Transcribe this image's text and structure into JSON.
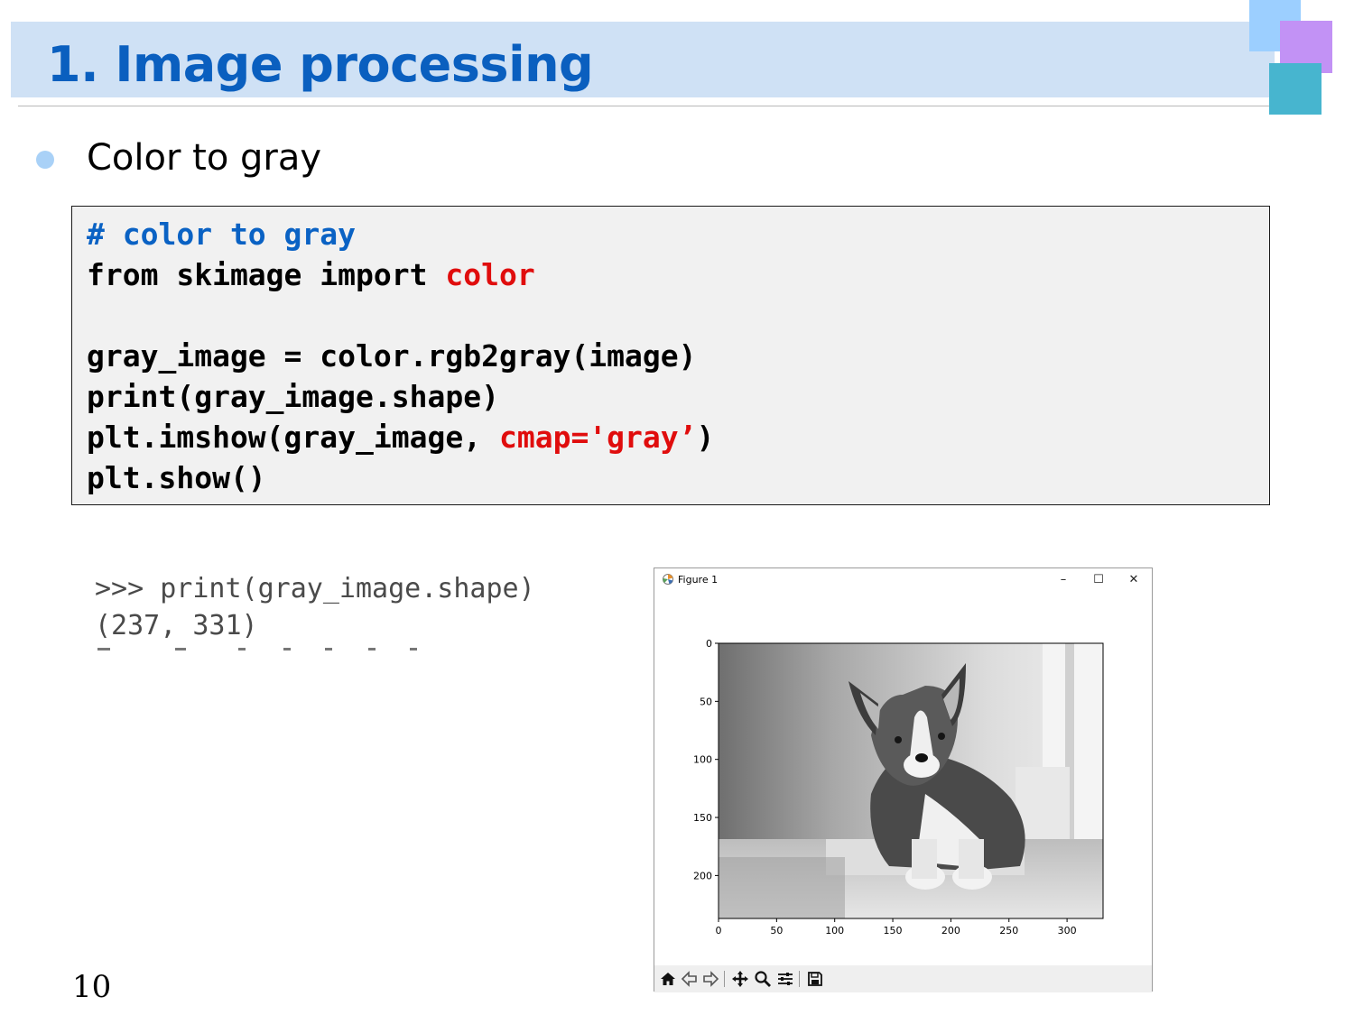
{
  "slide": {
    "title": "1. Image processing",
    "page_number": "10",
    "colors": {
      "title": "#0a5fbf",
      "band": "#cfe1f5",
      "accent_blue": "#9ccfff",
      "accent_purple": "#c292f5",
      "accent_teal": "#47b5cf"
    }
  },
  "bullet": {
    "text": "Color to gray"
  },
  "code": {
    "comment": "# color to gray",
    "import_prefix": "from skimage import ",
    "import_name": "color",
    "line_assign": "gray_image = color.rgb2gray(image)",
    "line_print": "print(gray_image.shape)",
    "line_imshow_prefix": "plt.imshow(gray_image, ",
    "line_imshow_arg": "cmap='gray’",
    "line_imshow_suffix": ")",
    "line_show": "plt.show()"
  },
  "console": {
    "line1": ">>> print(gray_image.shape)",
    "line2": "(237, 331)"
  },
  "figure_window": {
    "title": "Figure 1",
    "buttons": {
      "minimize": "–",
      "maximize": "☐",
      "close": "✕"
    },
    "image_description": "grayscale photo of a dog",
    "image_shape": [
      237,
      331
    ],
    "x_ticks": [
      "0",
      "50",
      "100",
      "150",
      "200",
      "250",
      "300"
    ],
    "y_ticks": [
      "0",
      "50",
      "100",
      "150",
      "200"
    ],
    "toolbar": [
      "home-icon",
      "back-arrow-icon",
      "forward-arrow-icon",
      "pan-icon",
      "zoom-icon",
      "configure-subplots-icon",
      "save-icon"
    ]
  }
}
